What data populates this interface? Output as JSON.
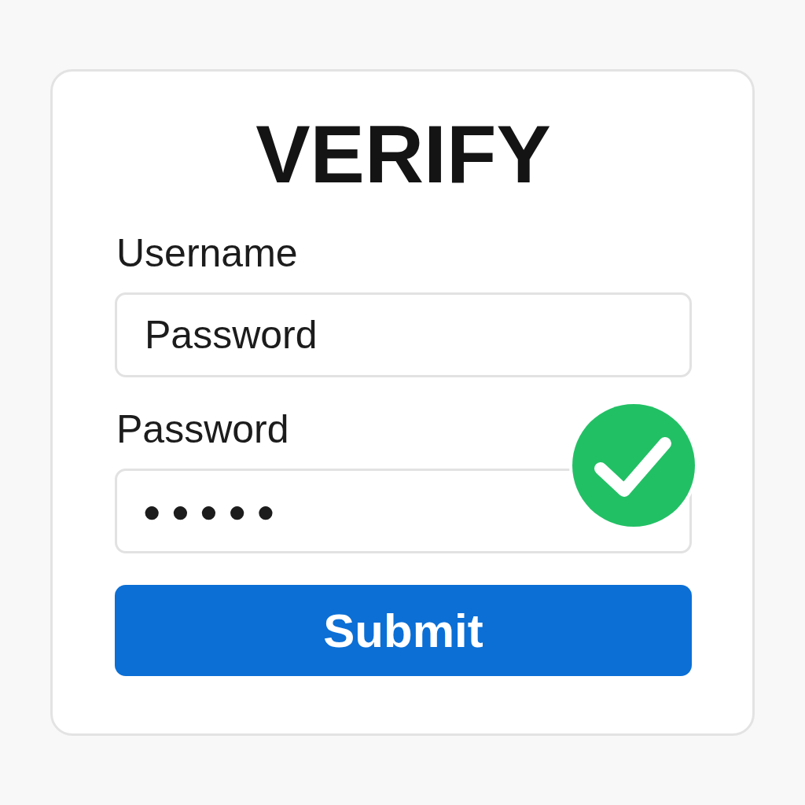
{
  "title": "VERIFY",
  "fields": [
    {
      "label": "Username",
      "value": "Password",
      "masked": false,
      "valid": false
    },
    {
      "label": "Password",
      "value": "●●●●●",
      "masked": true,
      "valid": true
    }
  ],
  "button": {
    "label": "Submit"
  }
}
